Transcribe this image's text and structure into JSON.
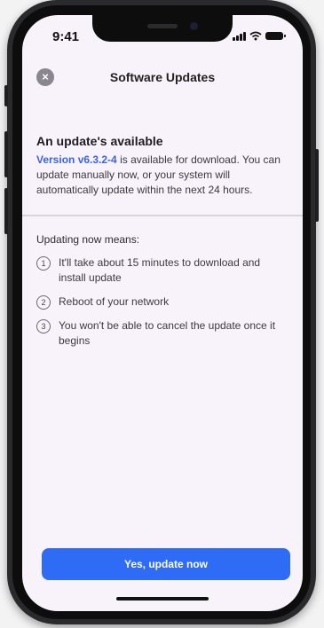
{
  "status_bar": {
    "time": "9:41"
  },
  "header": {
    "close_icon_glyph": "×",
    "title": "Software Updates"
  },
  "update": {
    "heading": "An update's available",
    "version_link": "Version v6.3.2-4",
    "body_text": " is available for download. You can update manually now, or your system will automatically update within the next 24 hours."
  },
  "means": {
    "heading": "Updating now means:",
    "items": [
      {
        "number": "1",
        "text": "It'll take about 15 minutes to download and install update"
      },
      {
        "number": "2",
        "text": "Reboot of your network"
      },
      {
        "number": "3",
        "text": "You won't be able to cancel the update once it begins"
      }
    ]
  },
  "actions": {
    "primary_label": "Yes, update now"
  },
  "colors": {
    "accent": "#2f6cf5",
    "link": "#3a63e6",
    "background": "#f8f3fa"
  }
}
